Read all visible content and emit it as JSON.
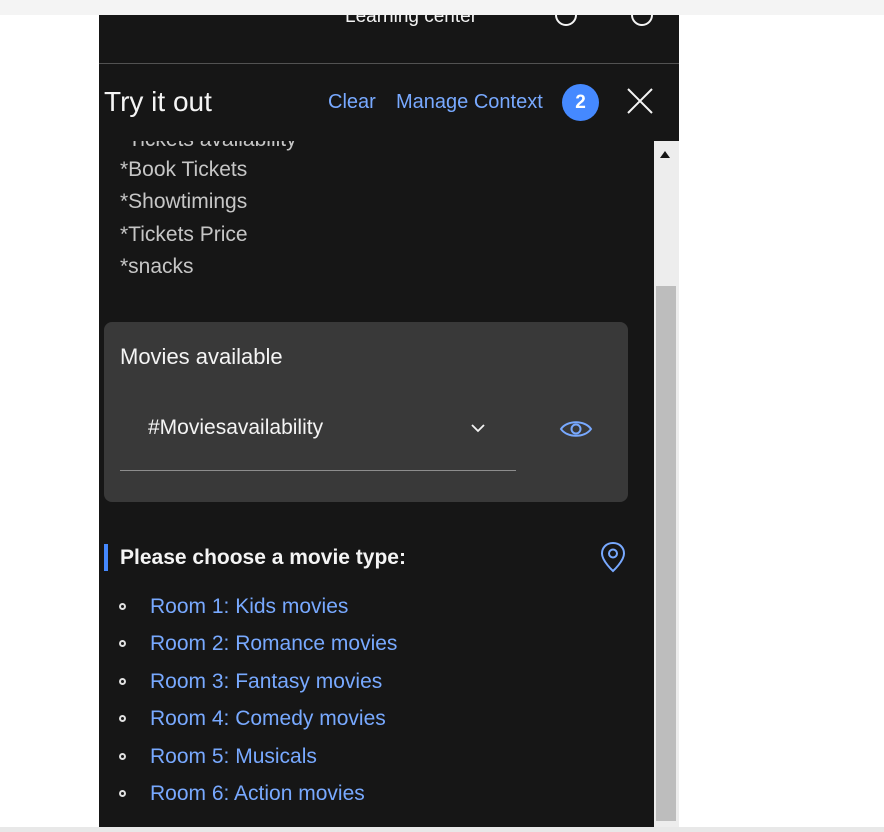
{
  "header": {
    "learning_center": "Learning center",
    "panel_title": "Try it out",
    "clear_label": "Clear",
    "manage_context_label": "Manage Context",
    "context_count": "2",
    "close_icon": "close-icon"
  },
  "conversation": {
    "partial_topic": "*Tickets availability",
    "topics": [
      "*Book Tickets",
      "*Showtimings",
      "*Tickets Price",
      "*snacks"
    ],
    "intent_card": {
      "title": "Movies available",
      "selected_intent": "#Moviesavailability",
      "dropdown_icon": "chevron-down-icon",
      "view_icon": "eye-icon"
    },
    "response": {
      "title": "Please choose a movie type:",
      "location_icon": "location-pin-icon",
      "options": [
        "Room 1: Kids movies",
        "Room 2: Romance movies",
        "Room 3: Fantasy movies",
        "Room 4: Comedy movies",
        "Room 5: Musicals",
        "Room 6: Action movies"
      ]
    }
  },
  "colors": {
    "panel_background": "#161616",
    "card_background": "#393939",
    "link": "#78a9ff",
    "accent": "#4589ff",
    "text": "#f4f4f4",
    "muted_text": "#c6c6c6"
  }
}
